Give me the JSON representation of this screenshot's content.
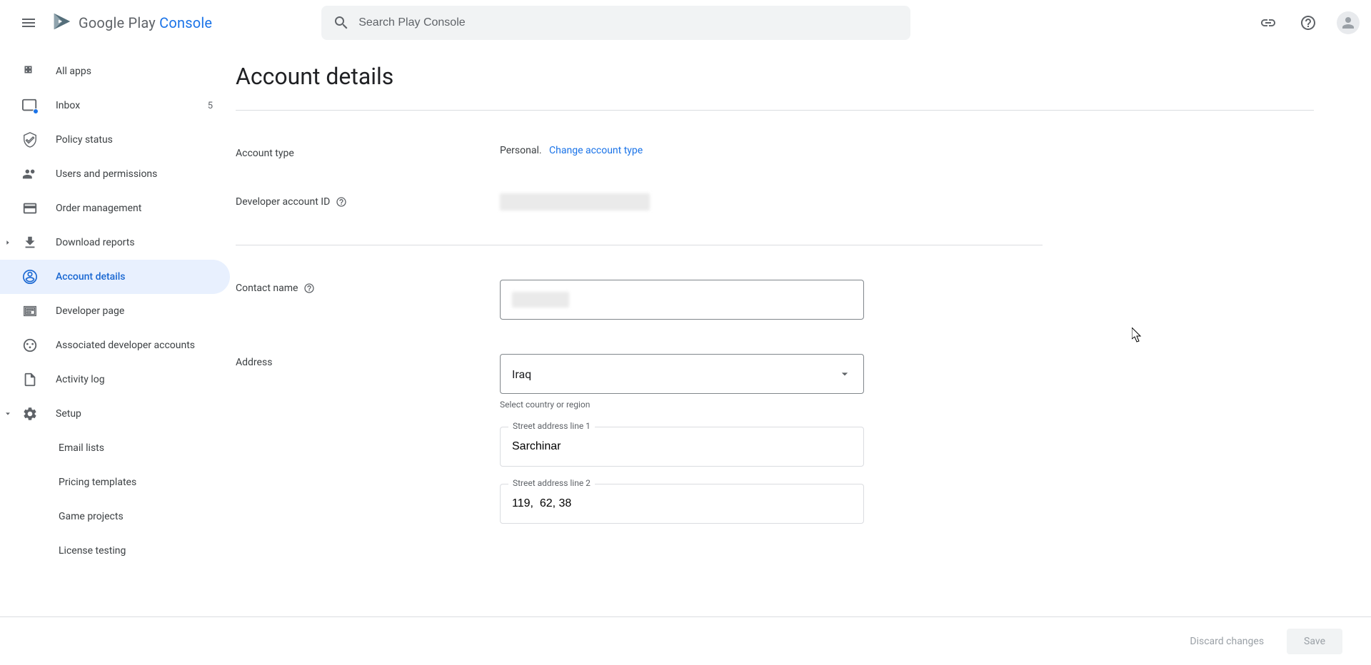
{
  "header": {
    "brand_main": "Google Play",
    "brand_sub": "Console",
    "search_placeholder": "Search Play Console"
  },
  "sidebar": {
    "items": [
      {
        "label": "All apps"
      },
      {
        "label": "Inbox",
        "count": "5"
      },
      {
        "label": "Policy status"
      },
      {
        "label": "Users and permissions"
      },
      {
        "label": "Order management"
      },
      {
        "label": "Download reports"
      },
      {
        "label": "Account details"
      },
      {
        "label": "Developer page"
      },
      {
        "label": "Associated developer accounts"
      },
      {
        "label": "Activity log"
      },
      {
        "label": "Setup"
      },
      {
        "label": "Email lists"
      },
      {
        "label": "Pricing templates"
      },
      {
        "label": "Game projects"
      },
      {
        "label": "License testing"
      }
    ]
  },
  "page": {
    "title": "Account details",
    "account_type_label": "Account type",
    "account_type_value": "Personal.",
    "change_account_type": "Change account type",
    "developer_id_label": "Developer account ID",
    "contact_name_label": "Contact name",
    "address_label": "Address",
    "country_value": "Iraq",
    "country_helper": "Select country or region",
    "street1_label": "Street address line 1",
    "street1_value": "Sarchinar",
    "street2_label": "Street address line 2",
    "street2_value": "119,  62, 38"
  },
  "footer": {
    "discard": "Discard changes",
    "save": "Save"
  }
}
